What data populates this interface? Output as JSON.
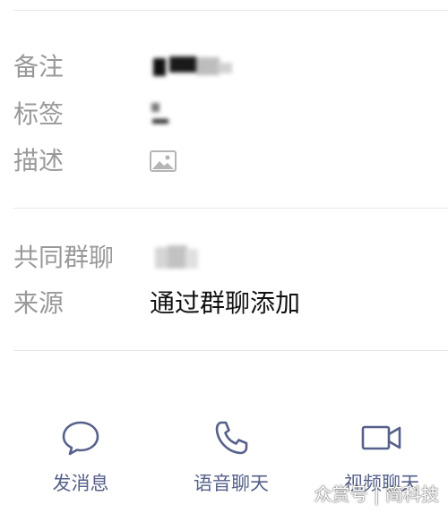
{
  "profile": {
    "remark_label": "备注",
    "tags_label": "标签",
    "description_label": "描述",
    "common_groups_label": "共同群聊",
    "source_label": "来源",
    "source_value": "通过群聊添加"
  },
  "actions": {
    "message": "发消息",
    "voice_call": "语音聊天",
    "video_call": "视频聊天"
  },
  "colors": {
    "label": "#999999",
    "value": "#111111",
    "action": "#56608a",
    "divider": "#e8e8e8"
  },
  "icons": {
    "description": "image-icon",
    "message": "chat-bubble-icon",
    "voice_call": "phone-icon",
    "video_call": "video-camera-icon"
  },
  "watermark": "众赏号 | 简科技"
}
